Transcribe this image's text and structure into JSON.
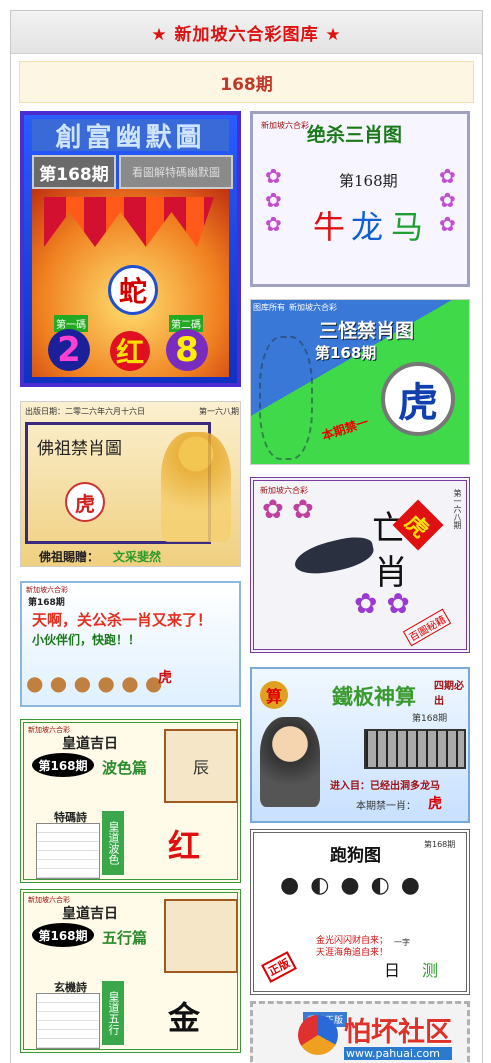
{
  "header": {
    "title": "★ 新加坡六合彩图库 ★"
  },
  "issue": {
    "label": "168期"
  },
  "colors": {
    "title_red": "#d11111",
    "issue_bg": "#fdf6e3"
  },
  "cards": {
    "c1": {
      "title": "創富幽默圖",
      "issue": "第168期",
      "sub": "看圖解特碼幽默圖",
      "zodiac": "蛇",
      "left_label": "第一碼",
      "right_label": "第二碼",
      "num1": "2",
      "color": "红",
      "num2": "8"
    },
    "c2": {
      "brand": "新加坡六合彩",
      "title": "绝杀三肖图",
      "issue": "第168期",
      "z1": "牛",
      "z2": "龙",
      "z3": "马"
    },
    "c3": {
      "brand": "新加坡六合彩",
      "tag": "图库所有",
      "title": "三怪禁肖图",
      "issue": "第168期",
      "zodiac": "虎",
      "note": "本期禁一"
    },
    "c4": {
      "header": "出版日期：二零二六年六月十六日",
      "issue": "第一六八期",
      "title": "佛祖禁肖圖",
      "zodiac": "虎",
      "footer": "佛祖賜贈：",
      "slogan": "文采斐然"
    },
    "c5": {
      "brand": "新加坡六合彩",
      "side": "第一六八期",
      "zodiac": "虎",
      "title1": "亡",
      "title2": "肖",
      "stamp": "百圖秘籍"
    },
    "c6": {
      "brand": "新加坡六合彩",
      "issue": "第168期",
      "headline": "天啊，关公杀一肖又来了！",
      "sub": "小伙伴们，快跑！！",
      "zodiac": "虎"
    },
    "c7": {
      "brand": "新加坡六合彩",
      "seal": "算",
      "title": "鐵板神算",
      "side": "四期必出",
      "issue": "第168期",
      "line": "进入目：已经出洞多龙马",
      "ban": "本期禁一肖：",
      "zodiac": "虎"
    },
    "c8": {
      "brand": "新加坡六合彩",
      "title": "皇道吉日",
      "issue": "第168期",
      "section": "波色篇",
      "box_title": "特碼詩",
      "corner": "辰",
      "vertical": "皇道波色",
      "answer": "红"
    },
    "c9": {
      "title": "跑狗图",
      "issue": "第168期",
      "line1": "金光闪闪财自来；",
      "line2": "天涯海角追自来！",
      "center": "一字",
      "d1": "日",
      "d2": "测",
      "stamp": "正版"
    },
    "c10": {
      "brand": "新加坡六合彩",
      "title": "皇道吉日",
      "issue": "第168期",
      "section": "五行篇",
      "box_title": "玄機詩",
      "vertical": "皇道五行",
      "answer": "金"
    },
    "c11": {
      "brand": "香港正版"
    }
  },
  "watermark": {
    "site": "怕坏社区",
    "url": "www.pahuai.com"
  }
}
